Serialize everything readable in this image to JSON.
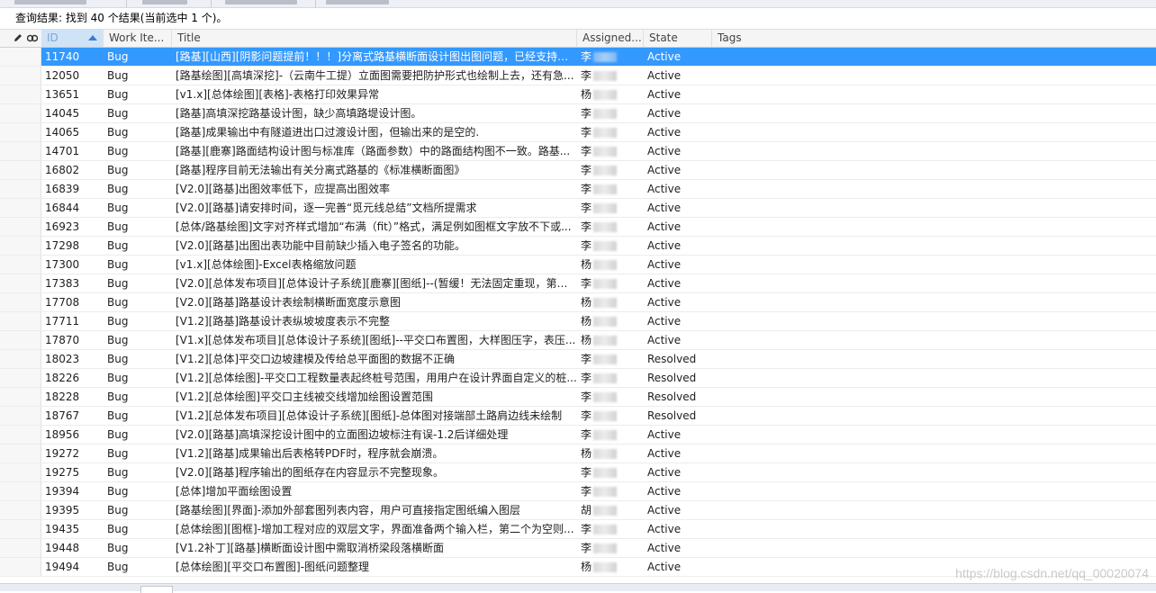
{
  "query_result": "查询结果: 找到 40 个结果(当前选中 1 个)。",
  "columns": {
    "id": "ID",
    "work_item_type": "Work Ite...",
    "title": "Title",
    "assigned_to": "Assigned...",
    "state": "State",
    "tags": "Tags"
  },
  "rows": [
    {
      "id": "11740",
      "type": "Bug",
      "title": "[路基][山西][阴影问题提前！！！]分离式路基横断面设计图出图问题，已经支持，...",
      "assigned": "李",
      "state": "Active",
      "selected": true
    },
    {
      "id": "12050",
      "type": "Bug",
      "title": "[路基绘图][高填深挖]-（云南牛工提）立面图需要把防护形式也绘制上去，还有急...",
      "assigned": "李",
      "state": "Active"
    },
    {
      "id": "13651",
      "type": "Bug",
      "title": "[v1.x][总体绘图][表格]-表格打印效果异常",
      "assigned": "杨",
      "state": "Active"
    },
    {
      "id": "14045",
      "type": "Bug",
      "title": "[路基]高填深挖路基设计图，缺少高填路堤设计图。",
      "assigned": "李",
      "state": "Active"
    },
    {
      "id": "14065",
      "type": "Bug",
      "title": "[路基]成果输出中有隧道进出口过渡设计图，但输出来的是空的.",
      "assigned": "李",
      "state": "Active"
    },
    {
      "id": "14701",
      "type": "Bug",
      "title": "[路基][鹿寨]路面结构设计图与标准库（路面参数）中的路面结构图不一致。路基...",
      "assigned": "李",
      "state": "Active"
    },
    {
      "id": "16802",
      "type": "Bug",
      "title": "[路基]程序目前无法输出有关分离式路基的《标准横断面图》",
      "assigned": "李",
      "state": "Active"
    },
    {
      "id": "16839",
      "type": "Bug",
      "title": "[V2.0][路基]出图效率低下，应提高出图效率",
      "assigned": "李",
      "state": "Active"
    },
    {
      "id": "16844",
      "type": "Bug",
      "title": "[V2.0][路基]请安排时间，逐一完善“觅元线总结”文档所提需求",
      "assigned": "李",
      "state": "Active"
    },
    {
      "id": "16923",
      "type": "Bug",
      "title": "[总体/路基绘图]文字对齐样式增加“布满（fit）”格式，满足例如图框文字放不下或...",
      "assigned": "李",
      "state": "Active"
    },
    {
      "id": "17298",
      "type": "Bug",
      "title": "[V2.0][路基]出图出表功能中目前缺少插入电子签名的功能。",
      "assigned": "李",
      "state": "Active"
    },
    {
      "id": "17300",
      "type": "Bug",
      "title": "[v1.x][总体绘图]-Excel表格缩放问题",
      "assigned": "杨",
      "state": "Active"
    },
    {
      "id": "17383",
      "type": "Bug",
      "title": "[V2.0][总体发布项目][总体设计子系统][鹿寨][图纸]--(暂缓！无法固定重现，第三...",
      "assigned": "李",
      "state": "Active"
    },
    {
      "id": "17708",
      "type": "Bug",
      "title": "[V2.0][路基]路基设计表绘制横断面宽度示意图",
      "assigned": "杨",
      "state": "Active"
    },
    {
      "id": "17711",
      "type": "Bug",
      "title": "[V1.2][路基]路基设计表纵坡坡度表示不完整",
      "assigned": "杨",
      "state": "Active"
    },
    {
      "id": "17870",
      "type": "Bug",
      "title": "[V1.x][总体发布项目][总体设计子系统][图纸]--平交口布置图，大样图压字，表压...",
      "assigned": "杨",
      "state": "Active"
    },
    {
      "id": "18023",
      "type": "Bug",
      "title": "[V1.2][总体]平交口边坡建模及传给总平面图的数据不正确",
      "assigned": "李",
      "state": "Resolved"
    },
    {
      "id": "18226",
      "type": "Bug",
      "title": "[V1.2][总体绘图]-平交口工程数量表起终桩号范围，用用户在设计界面自定义的桩...",
      "assigned": "李",
      "state": "Resolved"
    },
    {
      "id": "18228",
      "type": "Bug",
      "title": "[V1.2][总体绘图]平交口主线被交线增加绘图设置范围",
      "assigned": "李",
      "state": "Resolved"
    },
    {
      "id": "18767",
      "type": "Bug",
      "title": "[V1.2][总体发布项目][总体设计子系统][图纸]-总体图对接端部土路肩边线未绘制",
      "assigned": "李",
      "state": "Resolved"
    },
    {
      "id": "18956",
      "type": "Bug",
      "title": "[V2.0][路基]高填深挖设计图中的立面图边坡标注有误-1.2后详细处理",
      "assigned": "李",
      "state": "Active"
    },
    {
      "id": "19272",
      "type": "Bug",
      "title": "[V1.2][路基]成果输出后表格转PDF时，程序就会崩溃。",
      "assigned": "杨",
      "state": "Active"
    },
    {
      "id": "19275",
      "type": "Bug",
      "title": "[V2.0][路基]程序输出的图纸存在内容显示不完整现象。",
      "assigned": "李",
      "state": "Active"
    },
    {
      "id": "19394",
      "type": "Bug",
      "title": "[总体]增加平面绘图设置",
      "assigned": "李",
      "state": "Active"
    },
    {
      "id": "19395",
      "type": "Bug",
      "title": "[路基绘图][界面]-添加外部套图列表内容，用户可直接指定图纸编入图层",
      "assigned": "胡",
      "state": "Active"
    },
    {
      "id": "19435",
      "type": "Bug",
      "title": "[总体绘图][图框]-增加工程对应的双层文字，界面准备两个输入栏，第二个为空则...",
      "assigned": "李",
      "state": "Active"
    },
    {
      "id": "19448",
      "type": "Bug",
      "title": "[V1.2补丁][路基]横断面设计图中需取消桥梁段落横断面",
      "assigned": "李",
      "state": "Active"
    },
    {
      "id": "19494",
      "type": "Bug",
      "title": "[总体绘图][平交口布置图]-图纸问题整理",
      "assigned": "杨",
      "state": "Active"
    }
  ],
  "watermark": "https://blog.csdn.net/qq_00020074",
  "colors": {
    "selection": "#3399ff",
    "header_bg": "#f5f5f5",
    "sorted_header_bg": "#cfe3f7"
  },
  "icons": [
    "pencil-icon",
    "link-icon",
    "sort-ascending-icon"
  ]
}
